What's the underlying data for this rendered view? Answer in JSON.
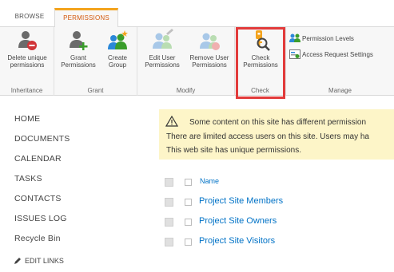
{
  "tabs": {
    "browse": "BROWSE",
    "permissions": "PERMISSIONS"
  },
  "ribbon": {
    "inheritance": {
      "delete_unique": "Delete unique\npermissions",
      "group_label": "Inheritance"
    },
    "grant": {
      "grant_permissions": "Grant\nPermissions",
      "create_group": "Create\nGroup",
      "group_label": "Grant"
    },
    "modify": {
      "edit_user": "Edit User\nPermissions",
      "remove_user": "Remove User\nPermissions",
      "group_label": "Modify"
    },
    "check": {
      "check_permissions": "Check\nPermissions",
      "group_label": "Check"
    },
    "manage": {
      "permission_levels": "Permission Levels",
      "access_request": "Access Request Settings",
      "group_label": "Manage"
    }
  },
  "nav": {
    "items": [
      "HOME",
      "DOCUMENTS",
      "CALENDAR",
      "TASKS",
      "CONTACTS",
      "ISSUES LOG",
      "Recycle Bin"
    ],
    "edit_links": "EDIT LINKS"
  },
  "warning": {
    "line1": "Some content on this site has different permission",
    "line2": "There are limited access users on this site. Users may ha",
    "line3": "This web site has unique permissions."
  },
  "list": {
    "header": "Name",
    "rows": [
      "Project Site Members",
      "Project Site Owners",
      "Project Site Visitors"
    ]
  },
  "colors": {
    "accent_tab": "#f3a31d",
    "link": "#0072c6",
    "highlight": "#e23b3b",
    "warning_bg": "#fdf5c8"
  }
}
